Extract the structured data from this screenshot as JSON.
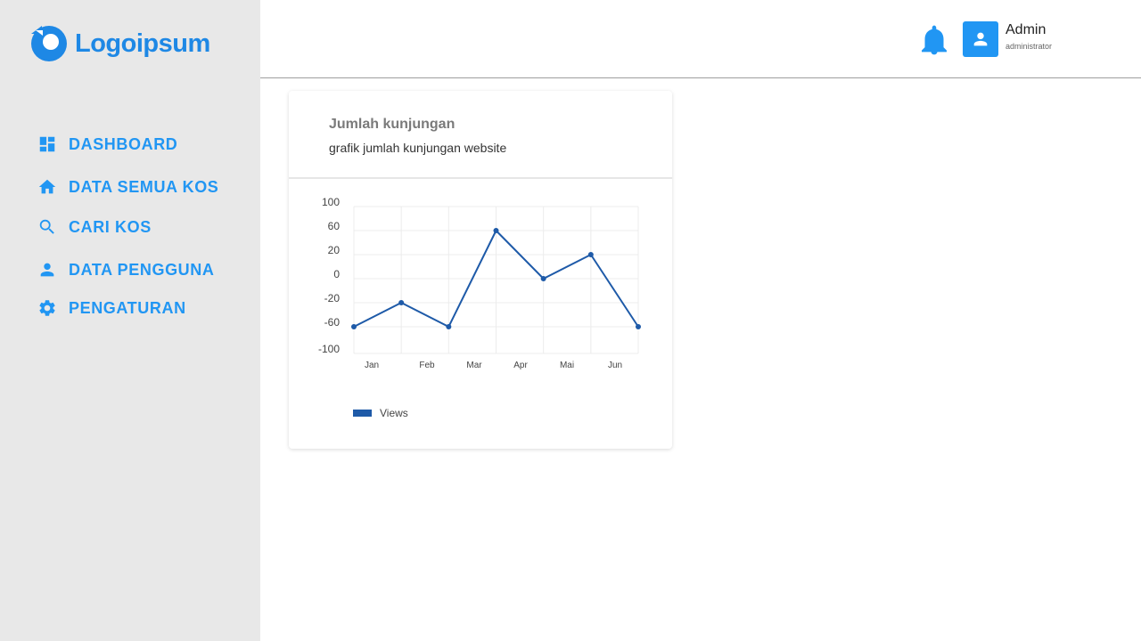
{
  "brand": {
    "name": "Logoipsum",
    "color": "#1e88e5"
  },
  "sidebar": {
    "items": [
      {
        "label": "DASHBOARD",
        "icon": "dashboard-icon"
      },
      {
        "label": "DATA SEMUA KOS",
        "icon": "home-icon"
      },
      {
        "label": "CARI KOS",
        "icon": "search-icon"
      },
      {
        "label": "DATA PENGGUNA",
        "icon": "person-icon"
      },
      {
        "label": "PENGATURAN",
        "icon": "gear-icon"
      }
    ]
  },
  "header": {
    "notification_icon": "bell-icon",
    "user": {
      "name": "Admin",
      "role": "administrator",
      "avatar_icon": "person-icon"
    }
  },
  "card": {
    "title": "Jumlah kunjungan",
    "subtitle": "grafik jumlah kunjungan website"
  },
  "chart_data": {
    "type": "line",
    "x": [
      "Jan",
      "",
      "Feb",
      "Mar",
      "Apr",
      "Mai",
      "Jun"
    ],
    "x_tick_labels": [
      "Jan",
      "Feb",
      "Mar",
      "Apr",
      "Mai",
      "Jun"
    ],
    "y_tick_labels": [
      "100",
      "60",
      "20",
      "0",
      "-20",
      "-60",
      "-100"
    ],
    "ylim": [
      -100,
      100
    ],
    "series": [
      {
        "name": "Views",
        "color": "#1e5aa8",
        "values": [
          -60,
          -20,
          -60,
          60,
          0,
          20,
          -60
        ]
      }
    ],
    "grid": true,
    "legend": "bottom-left"
  }
}
